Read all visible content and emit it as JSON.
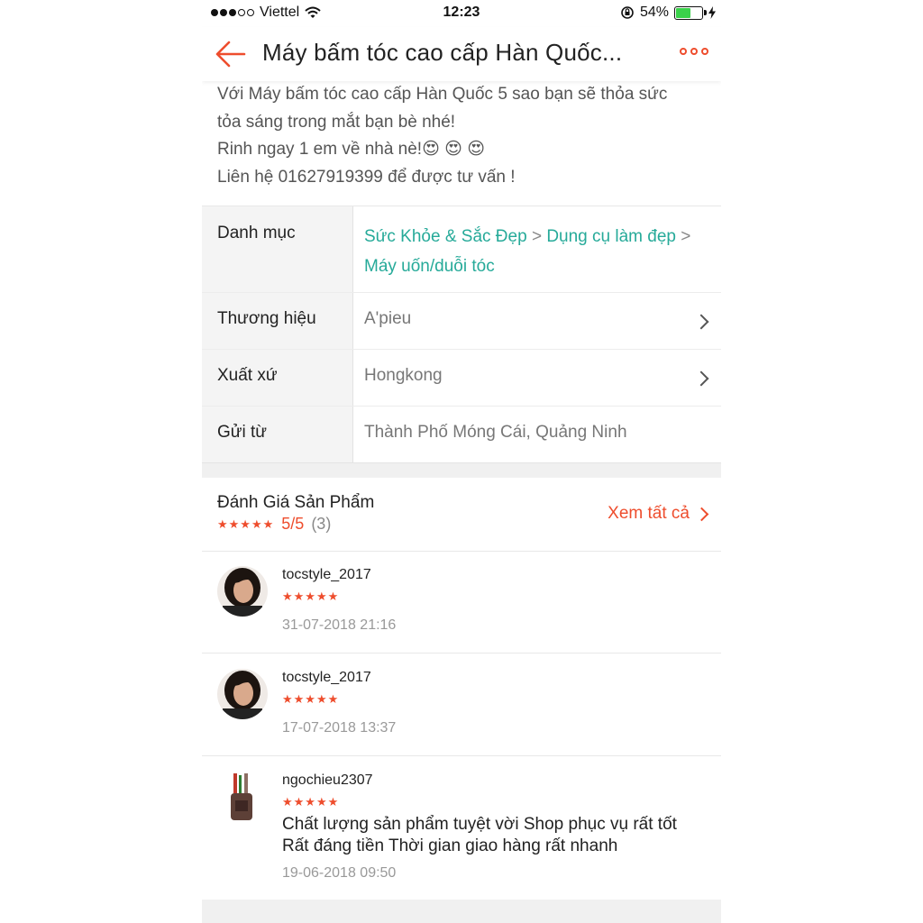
{
  "status_bar": {
    "carrier": "Viettel",
    "time": "12:23",
    "battery_percent": "54%",
    "battery_level": 0.54,
    "signal_bars": 3
  },
  "header": {
    "title": "Máy bấm tóc cao cấp Hàn Quốc...",
    "accent_color": "#ee4d2d"
  },
  "description": {
    "lines": [
      "Với Máy bấm tóc cao cấp Hàn Quốc 5 sao bạn sẽ thỏa sức",
      "tỏa sáng trong mắt bạn bè nhé!",
      "Rinh ngay 1 em  về nhà nè!😍 😍 😍",
      "Liên hệ 01627919399 để được tư vấn !"
    ]
  },
  "specs": {
    "category_label": "Danh mục",
    "category_path": [
      "Sức Khỏe & Sắc Đẹp",
      "Dụng cụ làm đẹp",
      "Máy uốn/duỗi tóc"
    ],
    "category_separator": ">",
    "brand_label": "Thương hiệu",
    "brand_value": "A'pieu",
    "origin_label": "Xuất xứ",
    "origin_value": "Hongkong",
    "ship_from_label": "Gửi từ",
    "ship_from_value": "Thành Phố Móng Cái, Quảng Ninh",
    "link_color": "#26aa99"
  },
  "reviews": {
    "title": "Đánh Giá Sản Phẩm",
    "stars": "★★★★★",
    "score": "5/5",
    "count": "(3)",
    "see_all": "Xem tất cả",
    "items": [
      {
        "user": "tocstyle_2017",
        "stars": "★★★★★",
        "date": "31-07-2018 21:16",
        "text": []
      },
      {
        "user": "tocstyle_2017",
        "stars": "★★★★★",
        "date": "17-07-2018 13:37",
        "text": []
      },
      {
        "user": "ngochieu2307",
        "stars": "★★★★★",
        "date": "19-06-2018 09:50",
        "text": [
          "Chất lượng sản phẩm tuyệt vời Shop phục vụ rất tốt",
          "Rất đáng tiền Thời gian giao hàng rất nhanh"
        ]
      }
    ]
  }
}
